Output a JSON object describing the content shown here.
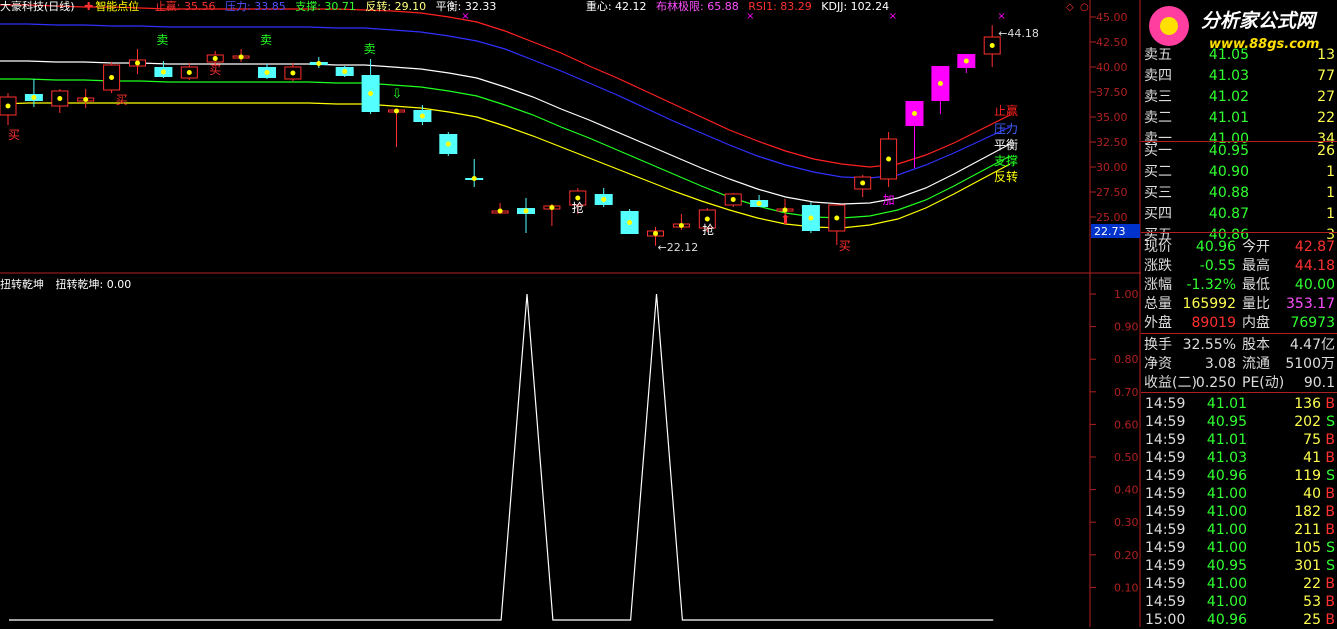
{
  "header": {
    "name": "大豪科技(日线)",
    "indicator": "智能点位",
    "stop_profit": "止赢: 35.56",
    "pressure": "压力: 33.85",
    "support": "支撑: 30.71",
    "reverse": "反转: 29.10",
    "balance": "平衡: 32.33",
    "gravity": "重心: 42.12",
    "boll": "布林极限: 65.88",
    "rsi": "RSI1: 83.29",
    "kdjj": "KDJJ: 102.24"
  },
  "sub_header": {
    "title": "扭转乾坤",
    "value": "扭转乾坤: 0.00"
  },
  "colors": {
    "up": "#ff3030",
    "down": "#54ffff",
    "magenta": "#ff00ff",
    "yellow": "#ffff00",
    "white": "#ffffff",
    "green": "#20ff20",
    "red_line": "#ff2020",
    "blue_line": "#3030ff",
    "axis": "#b02020"
  },
  "main_axis_labels": [
    "45.00",
    "42.50",
    "40.00",
    "37.50",
    "35.00",
    "32.50",
    "30.00",
    "27.50",
    "25.00"
  ],
  "current_price_box": "22.73",
  "sub_axis_labels": [
    "1.00",
    "0.90",
    "0.80",
    "0.70",
    "0.60",
    "0.50",
    "0.40",
    "0.30",
    "0.20",
    "0.10"
  ],
  "line_labels": {
    "stop_profit": "止赢",
    "pressure": "压力",
    "balance": "平衡",
    "support": "支撑",
    "reverse": "反转"
  },
  "annotations": {
    "high": "44.18",
    "low": "22.12",
    "sell": "卖",
    "buy": "买",
    "grab": "抢",
    "add": "加"
  },
  "logo": {
    "title": "分析家公式网",
    "url": "www.88gs.com"
  },
  "sell_orders": [
    {
      "label": "卖五",
      "price": "41.05",
      "vol": "13"
    },
    {
      "label": "卖四",
      "price": "41.03",
      "vol": "77"
    },
    {
      "label": "卖三",
      "price": "41.02",
      "vol": "27"
    },
    {
      "label": "卖二",
      "price": "41.01",
      "vol": "22"
    },
    {
      "label": "卖一",
      "price": "41.00",
      "vol": "34"
    }
  ],
  "buy_orders": [
    {
      "label": "买一",
      "price": "40.95",
      "vol": "26"
    },
    {
      "label": "买二",
      "price": "40.90",
      "vol": "1"
    },
    {
      "label": "买三",
      "price": "40.88",
      "vol": "1"
    },
    {
      "label": "买四",
      "price": "40.87",
      "vol": "1"
    },
    {
      "label": "买五",
      "price": "40.86",
      "vol": "3"
    }
  ],
  "quote": [
    {
      "l1": "现价",
      "v1": "40.96",
      "l2": "今开",
      "v2": "42.87"
    },
    {
      "l1": "涨跌",
      "v1": "-0.55",
      "l2": "最高",
      "v2": "44.18"
    },
    {
      "l1": "涨幅",
      "v1": "-1.32%",
      "l2": "最低",
      "v2": "40.00"
    },
    {
      "l1": "总量",
      "v1": "165992",
      "l2": "量比",
      "v2": "353.17"
    },
    {
      "l1": "外盘",
      "v1": "89019",
      "l2": "内盘",
      "v2": "76973"
    }
  ],
  "stats": [
    {
      "l1": "换手",
      "v1": "32.55%",
      "l2": "股本",
      "v2": "4.47亿"
    },
    {
      "l1": "净资",
      "v1": "3.08",
      "l2": "流通",
      "v2": "5100万"
    },
    {
      "l1": "收益(二)",
      "v1": "0.250",
      "l2": "PE(动)",
      "v2": "90.1"
    }
  ],
  "ticks": [
    {
      "t": "14:59",
      "p": "41.01",
      "v": "136",
      "s": "B"
    },
    {
      "t": "14:59",
      "p": "40.95",
      "v": "202",
      "s": "S"
    },
    {
      "t": "14:59",
      "p": "41.01",
      "v": "75",
      "s": "B"
    },
    {
      "t": "14:59",
      "p": "41.03",
      "v": "41",
      "s": "B"
    },
    {
      "t": "14:59",
      "p": "40.96",
      "v": "119",
      "s": "S"
    },
    {
      "t": "14:59",
      "p": "41.00",
      "v": "40",
      "s": "B"
    },
    {
      "t": "14:59",
      "p": "41.00",
      "v": "182",
      "s": "B"
    },
    {
      "t": "14:59",
      "p": "41.00",
      "v": "211",
      "s": "B"
    },
    {
      "t": "14:59",
      "p": "41.00",
      "v": "105",
      "s": "S"
    },
    {
      "t": "14:59",
      "p": "40.95",
      "v": "301",
      "s": "S"
    },
    {
      "t": "14:59",
      "p": "41.00",
      "v": "22",
      "s": "B"
    },
    {
      "t": "14:59",
      "p": "41.00",
      "v": "53",
      "s": "B"
    },
    {
      "t": "15:00",
      "p": "40.96",
      "v": "25",
      "s": "B"
    }
  ],
  "chart_data": {
    "type": "candlestick",
    "ylim": [
      22,
      46
    ],
    "candles": [
      {
        "o": 35.2,
        "h": 37.4,
        "l": 34.2,
        "c": 37.0
      },
      {
        "o": 37.3,
        "h": 38.8,
        "l": 36.0,
        "c": 36.6
      },
      {
        "o": 36.1,
        "h": 37.8,
        "l": 35.4,
        "c": 37.6
      },
      {
        "o": 36.6,
        "h": 37.8,
        "l": 35.9,
        "c": 36.9
      },
      {
        "o": 37.7,
        "h": 40.5,
        "l": 37.4,
        "c": 40.2
      },
      {
        "o": 40.1,
        "h": 41.8,
        "l": 39.3,
        "c": 40.7
      },
      {
        "o": 40.0,
        "h": 40.6,
        "l": 38.9,
        "c": 39.0
      },
      {
        "o": 38.9,
        "h": 40.4,
        "l": 38.7,
        "c": 40.0
      },
      {
        "o": 40.5,
        "h": 41.6,
        "l": 40.1,
        "c": 41.2
      },
      {
        "o": 40.9,
        "h": 41.8,
        "l": 40.5,
        "c": 41.1
      },
      {
        "o": 40.0,
        "h": 40.3,
        "l": 38.8,
        "c": 38.9
      },
      {
        "o": 38.8,
        "h": 40.4,
        "l": 38.6,
        "c": 40.0
      },
      {
        "o": 40.5,
        "h": 41.0,
        "l": 39.9,
        "c": 40.2
      },
      {
        "o": 40.0,
        "h": 40.1,
        "l": 39.0,
        "c": 39.1
      },
      {
        "o": 39.2,
        "h": 40.8,
        "l": 35.3,
        "c": 35.5
      },
      {
        "o": 35.5,
        "h": 35.7,
        "l": 32.0,
        "c": 35.7
      },
      {
        "o": 35.7,
        "h": 36.2,
        "l": 34.2,
        "c": 34.5
      },
      {
        "o": 33.3,
        "h": 33.5,
        "l": 31.1,
        "c": 31.3
      },
      {
        "o": 28.9,
        "h": 30.8,
        "l": 28.0,
        "c": 28.8
      },
      {
        "o": 25.6,
        "h": 26.4,
        "l": 25.3,
        "c": 25.6
      },
      {
        "o": 25.9,
        "h": 26.9,
        "l": 23.4,
        "c": 25.3
      },
      {
        "o": 25.8,
        "h": 26.3,
        "l": 24.1,
        "c": 26.1
      },
      {
        "o": 26.2,
        "h": 27.9,
        "l": 25.3,
        "c": 27.6
      },
      {
        "o": 27.3,
        "h": 27.9,
        "l": 26.0,
        "c": 26.2
      },
      {
        "o": 25.6,
        "h": 25.8,
        "l": 23.3,
        "c": 23.3
      },
      {
        "o": 23.1,
        "h": 24.0,
        "l": 22.12,
        "c": 23.6
      },
      {
        "o": 24.0,
        "h": 25.3,
        "l": 23.7,
        "c": 24.3
      },
      {
        "o": 23.9,
        "h": 25.9,
        "l": 23.5,
        "c": 25.7
      },
      {
        "o": 26.2,
        "h": 27.4,
        "l": 26.0,
        "c": 27.3
      },
      {
        "o": 26.7,
        "h": 27.2,
        "l": 26.0,
        "c": 26.0
      },
      {
        "o": 25.6,
        "h": 26.8,
        "l": 24.5,
        "c": 25.8
      },
      {
        "o": 26.2,
        "h": 26.5,
        "l": 23.4,
        "c": 23.6
      },
      {
        "o": 23.6,
        "h": 26.3,
        "l": 22.2,
        "c": 26.2
      },
      {
        "o": 27.8,
        "h": 29.2,
        "l": 27.0,
        "c": 29.0
      },
      {
        "o": 28.8,
        "h": 33.5,
        "l": 28.0,
        "c": 32.8
      },
      {
        "o": 34.1,
        "h": 36.0,
        "l": 29.9,
        "c": 36.6
      },
      {
        "o": 36.6,
        "h": 38.6,
        "l": 35.3,
        "c": 40.1
      },
      {
        "o": 39.9,
        "h": 41.2,
        "l": 39.4,
        "c": 41.3
      },
      {
        "o": 41.3,
        "h": 44.18,
        "l": 40.0,
        "c": 43.0
      }
    ],
    "lines": [
      {
        "name": "止赢",
        "values": [
          46.2,
          46.2,
          46.1,
          46.0,
          46.0,
          45.9,
          45.8,
          45.8,
          45.8,
          45.8,
          45.8,
          45.8,
          45.8,
          45.7,
          45.6,
          45.4,
          45.0,
          44.5,
          43.6,
          42.5,
          41.4,
          40.1,
          38.9,
          37.6,
          36.3,
          35.0,
          33.7,
          32.6,
          31.6,
          30.8,
          30.3,
          30.0,
          30.3,
          31.2,
          32.4,
          33.8,
          35.2
        ]
      },
      {
        "name": "压力",
        "values": [
          44.3,
          44.3,
          44.2,
          44.2,
          44.1,
          44.1,
          44.0,
          44.0,
          44.0,
          44.0,
          44.0,
          44.0,
          43.9,
          43.9,
          43.7,
          43.5,
          43.1,
          42.6,
          41.8,
          40.7,
          39.6,
          38.4,
          37.2,
          35.9,
          34.6,
          33.4,
          32.2,
          31.1,
          30.2,
          29.5,
          29.0,
          28.9,
          29.2,
          30.2,
          31.4,
          32.7,
          34.0
        ]
      },
      {
        "name": "平衡",
        "values": [
          40.6,
          40.6,
          40.5,
          40.5,
          40.4,
          40.4,
          40.3,
          40.3,
          40.3,
          40.3,
          40.3,
          40.3,
          40.2,
          40.2,
          40.0,
          39.8,
          39.4,
          38.9,
          38.0,
          37.0,
          35.8,
          34.7,
          33.5,
          32.3,
          31.1,
          29.9,
          28.8,
          27.8,
          27.0,
          26.5,
          26.3,
          26.4,
          26.9,
          27.9,
          29.3,
          30.8,
          32.3
        ]
      },
      {
        "name": "支撑",
        "values": [
          38.8,
          38.8,
          38.7,
          38.7,
          38.6,
          38.6,
          38.5,
          38.5,
          38.5,
          38.5,
          38.5,
          38.5,
          38.4,
          38.4,
          38.2,
          38.0,
          37.6,
          37.1,
          36.2,
          35.2,
          34.0,
          32.9,
          31.7,
          30.5,
          29.3,
          28.1,
          27.0,
          26.1,
          25.4,
          25.0,
          24.9,
          25.1,
          25.7,
          26.7,
          28.1,
          29.6,
          31.1
        ]
      },
      {
        "name": "反转",
        "values": [
          36.3,
          36.4,
          36.4,
          36.4,
          36.4,
          36.4,
          36.4,
          36.4,
          36.4,
          36.4,
          36.4,
          36.4,
          36.3,
          36.3,
          36.1,
          35.9,
          35.5,
          35.0,
          34.1,
          33.1,
          32.0,
          30.9,
          29.8,
          28.7,
          27.6,
          26.6,
          25.7,
          24.9,
          24.3,
          24.0,
          23.9,
          24.2,
          24.8,
          25.9,
          27.3,
          28.8,
          30.3
        ]
      }
    ],
    "sub": {
      "name": "扭转乾坤",
      "ylim": [
        0,
        1.05
      ],
      "values": [
        0,
        0,
        0,
        0,
        0,
        0,
        0,
        0,
        0,
        0,
        0,
        0,
        0,
        0,
        0,
        0,
        0,
        0,
        0,
        0,
        1,
        0,
        0,
        0,
        0,
        1,
        0,
        0,
        0,
        0,
        0,
        0,
        0,
        0,
        0,
        0,
        0,
        0,
        0
      ]
    }
  }
}
